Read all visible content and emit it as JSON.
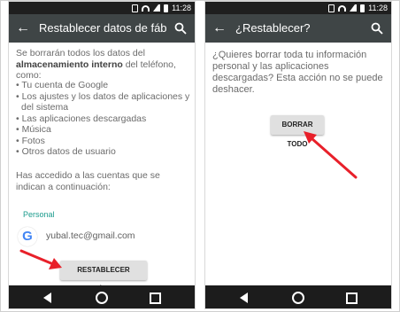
{
  "status": {
    "time": "11:28"
  },
  "left": {
    "toolbar": {
      "title": "Restablecer datos de fábri…"
    },
    "intro_prefix": "Se borrarán todos los datos del ",
    "intro_bold": "almacenamiento interno",
    "intro_suffix": " del teléfono, como:",
    "items": [
      "• Tu cuenta de Google",
      "• Los ajustes y los datos de aplicaciones y",
      "  del sistema",
      "• Las aplicaciones descargadas",
      "• Música",
      "• Fotos",
      "• Otros datos de usuario"
    ],
    "accounts_text": "Has accedido a las cuentas que se indican a continuación:",
    "section": "Personal",
    "account_email": "yubal.tec@gmail.com",
    "reset_button": "RESTABLECER TELÉFONO"
  },
  "right": {
    "toolbar": {
      "title": "¿Restablecer?"
    },
    "message": "¿Quieres borrar toda tu información personal y las aplicaciones descargadas? Esta acción no se puede deshacer.",
    "erase_button": "BORRAR TODO"
  },
  "colors": {
    "toolbar": "#3f4546",
    "accent": "#1a9b8c",
    "arrow": "#e8202a"
  },
  "icons": [
    "back-arrow-icon",
    "search-icon",
    "google-icon",
    "nav-back-icon",
    "nav-home-icon",
    "nav-recents-icon"
  ]
}
